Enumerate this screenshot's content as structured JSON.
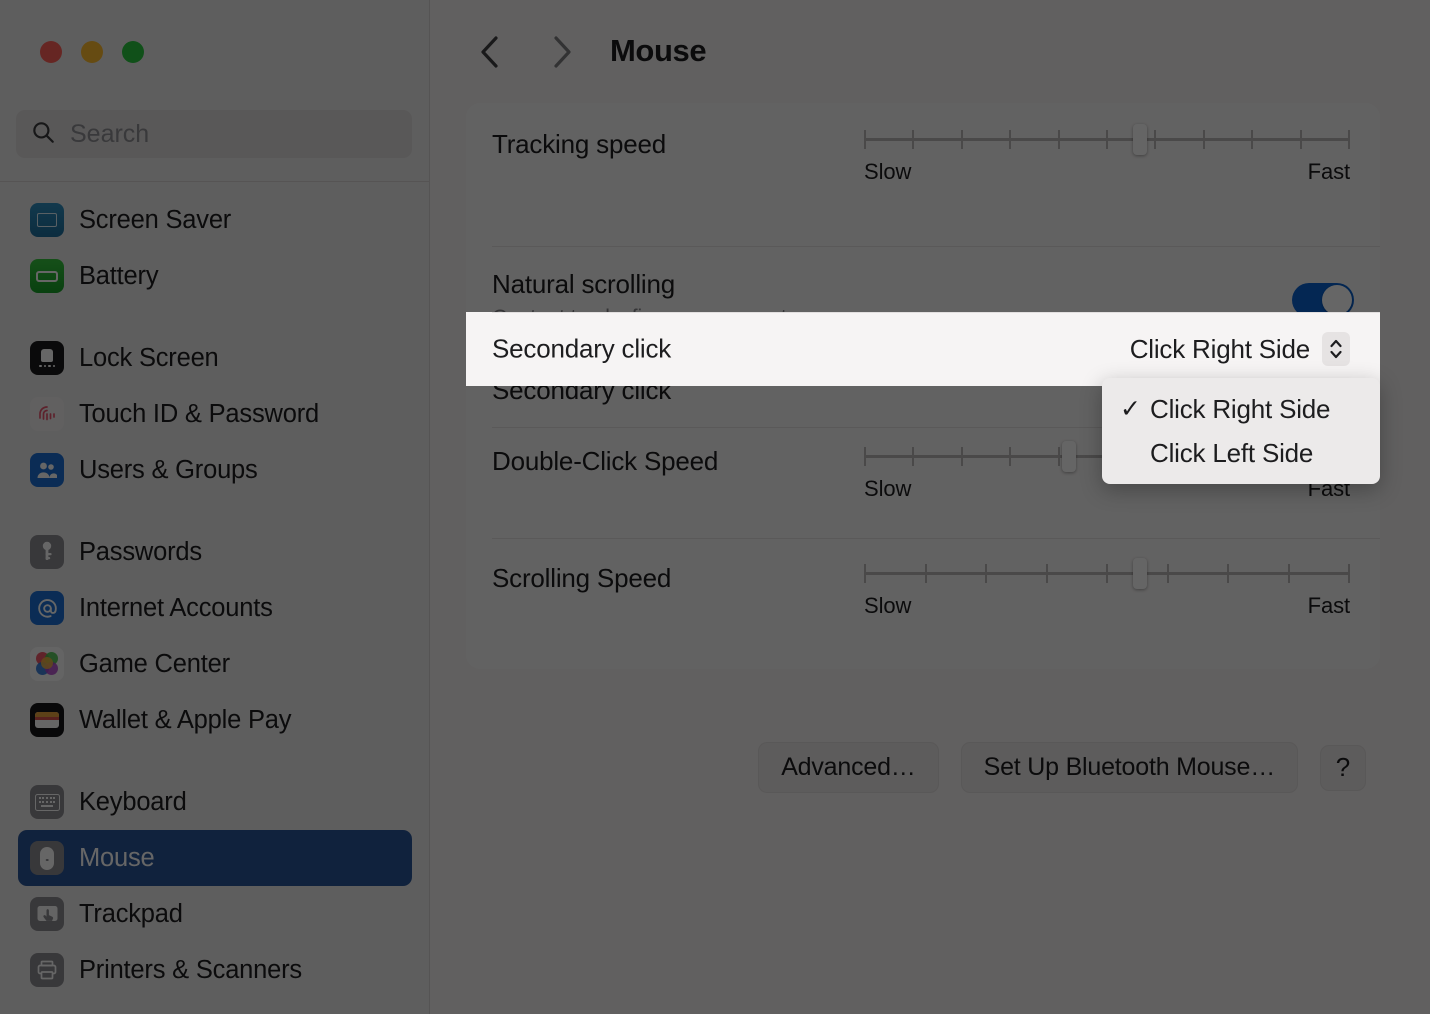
{
  "window": {
    "traffic_lights": [
      {
        "name": "close",
        "color": "#ff5f57"
      },
      {
        "name": "minimize",
        "color": "#febc2e"
      },
      {
        "name": "zoom",
        "color": "#28c840"
      }
    ]
  },
  "sidebar": {
    "search": {
      "value": "",
      "placeholder": "Search",
      "icon": "search-icon"
    },
    "groups": [
      {
        "items": [
          {
            "label": "Screen Saver",
            "icon": "screen-saver-icon"
          },
          {
            "label": "Battery",
            "icon": "battery-icon"
          }
        ]
      },
      {
        "items": [
          {
            "label": "Lock Screen",
            "icon": "lock-screen-icon"
          },
          {
            "label": "Touch ID & Password",
            "icon": "touch-id-icon"
          },
          {
            "label": "Users & Groups",
            "icon": "users-groups-icon"
          }
        ]
      },
      {
        "items": [
          {
            "label": "Passwords",
            "icon": "passwords-icon"
          },
          {
            "label": "Internet Accounts",
            "icon": "internet-accounts-icon"
          },
          {
            "label": "Game Center",
            "icon": "game-center-icon"
          },
          {
            "label": "Wallet & Apple Pay",
            "icon": "wallet-icon"
          }
        ]
      },
      {
        "items": [
          {
            "label": "Keyboard",
            "icon": "keyboard-icon"
          },
          {
            "label": "Mouse",
            "icon": "mouse-icon",
            "selected": true
          },
          {
            "label": "Trackpad",
            "icon": "trackpad-icon"
          },
          {
            "label": "Printers & Scanners",
            "icon": "printers-scanners-icon"
          }
        ]
      }
    ],
    "selected_accent": "#2a5699"
  },
  "toolbar": {
    "back_icon": "chevron-left-icon",
    "forward_icon": "chevron-right-icon",
    "title": "Mouse"
  },
  "settings": {
    "tracking_speed": {
      "label": "Tracking speed",
      "min_label": "Slow",
      "max_label": "Fast",
      "value_percent": 57,
      "tick_count": 10
    },
    "natural_scrolling": {
      "label": "Natural scrolling",
      "sublabel": "Content tracks finger movement",
      "enabled": true,
      "accent": "#0a62d0"
    },
    "secondary_click": {
      "label": "Secondary click",
      "value": "Click Right Side",
      "chevron_icon": "chevron-up-down-icon",
      "options": [
        {
          "label": "Click Right Side",
          "checked": true
        },
        {
          "label": "Click Left Side",
          "checked": false
        }
      ],
      "check_glyph": "✓"
    },
    "double_click_speed": {
      "label": "Double-Click Speed",
      "min_label": "Slow",
      "max_label": "Fast",
      "value_percent": 42,
      "tick_count": 10
    },
    "scrolling_speed": {
      "label": "Scrolling Speed",
      "min_label": "Slow",
      "max_label": "Fast",
      "value_percent": 57,
      "tick_count": 8
    }
  },
  "footer": {
    "advanced_label": "Advanced…",
    "bluetooth_label": "Set Up Bluetooth Mouse…",
    "help_label": "?"
  }
}
